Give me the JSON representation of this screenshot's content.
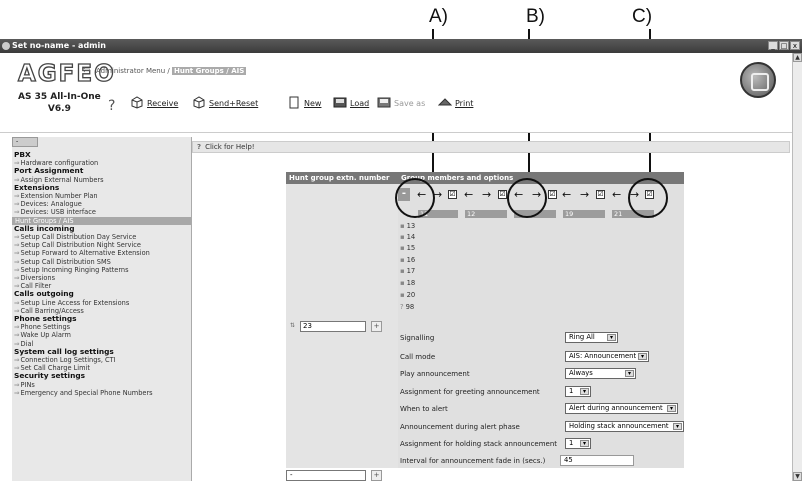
{
  "callouts": [
    "A)",
    "B)",
    "C)"
  ],
  "window": {
    "title": "Set no-name - admin",
    "min": "_",
    "max": "□",
    "close": "x"
  },
  "header": {
    "logo": "AGFEO",
    "nav_arrow": "⇦",
    "breadcrumb_admin": "Administrator Menu /",
    "breadcrumb_current": "Hunt Groups / AIS",
    "model_line1": "AS 35 All-In-One",
    "model_line2": "V6.9",
    "help": "?",
    "toolbar": [
      {
        "label": "Receive",
        "icon": "receive-icon"
      },
      {
        "label": "Send+Reset",
        "icon": "send-reset-icon"
      },
      {
        "label": "New",
        "icon": "new-icon"
      },
      {
        "label": "Load",
        "icon": "load-icon"
      },
      {
        "label": "Save as",
        "icon": "save-as-icon"
      },
      {
        "label": "Print",
        "icon": "print-icon"
      }
    ]
  },
  "sidebar": {
    "collapse": "-",
    "items": [
      {
        "type": "section",
        "label": "PBX"
      },
      {
        "type": "item",
        "label": "Hardware configuration"
      },
      {
        "type": "section",
        "label": "Port Assignment"
      },
      {
        "type": "item",
        "label": "Assign External Numbers"
      },
      {
        "type": "section",
        "label": "Extensions"
      },
      {
        "type": "item",
        "label": "Extension Number Plan"
      },
      {
        "type": "item",
        "label": "Devices: Analogue"
      },
      {
        "type": "item",
        "label": "Devices: USB interface"
      },
      {
        "type": "active",
        "label": "Hunt Groups / AIS"
      },
      {
        "type": "section",
        "label": "Calls incoming"
      },
      {
        "type": "item",
        "label": "Setup Call Distribution Day Service"
      },
      {
        "type": "item",
        "label": "Setup Call Distribution Night Service"
      },
      {
        "type": "item",
        "label": "Setup Forward to Alternative Extension"
      },
      {
        "type": "item",
        "label": "Setup Call Distribution SMS"
      },
      {
        "type": "item",
        "label": "Setup Incoming Ringing Patterns"
      },
      {
        "type": "item",
        "label": "Diversions"
      },
      {
        "type": "item",
        "label": "Call Filter"
      },
      {
        "type": "section",
        "label": "Calls outgoing"
      },
      {
        "type": "item",
        "label": "Setup Line Access for Extensions"
      },
      {
        "type": "item",
        "label": "Call Barring/Access"
      },
      {
        "type": "section",
        "label": "Phone settings"
      },
      {
        "type": "item",
        "label": "Phone Settings"
      },
      {
        "type": "item",
        "label": "Wake Up Alarm"
      },
      {
        "type": "item",
        "label": "Dial"
      },
      {
        "type": "section",
        "label": "System call log settings"
      },
      {
        "type": "item",
        "label": "Connection Log Settings, CTI"
      },
      {
        "type": "item",
        "label": "Set Call Charge Limit"
      },
      {
        "type": "section",
        "label": "Security settings"
      },
      {
        "type": "item",
        "label": "PINs"
      },
      {
        "type": "item",
        "label": "Emergency and Special Phone Numbers"
      }
    ]
  },
  "helpbar": {
    "icon": "?",
    "text": "Click for Help!"
  },
  "form": {
    "col1_header": "Hunt group extn. number",
    "col2_header": "Group members and options",
    "member_controls": [
      "-",
      "←",
      "→",
      "☑",
      "←",
      "→",
      "☑",
      "←",
      "→",
      "☑",
      "←",
      "→",
      "☑",
      "←",
      "→",
      "☑"
    ],
    "group_cells": [
      "11",
      "12",
      "18",
      "19",
      "21"
    ],
    "members": [
      "13",
      "14",
      "15",
      "16",
      "17",
      "18",
      "20",
      "98"
    ],
    "ext_number": "23",
    "ext_plus": "+",
    "options": [
      {
        "label": "Signalling",
        "value": "Ring All"
      },
      {
        "label": "Call mode",
        "value": "AIS: Announcement"
      },
      {
        "label": "Play announcement",
        "value": "Always"
      },
      {
        "label": "Assignment for greeting announcement",
        "value": "1"
      },
      {
        "label": "When to alert",
        "value": "Alert during announcement"
      },
      {
        "label": "Announcement during alert phase",
        "value": "Holding stack announcement"
      },
      {
        "label": "Assignment for holding stack announcement",
        "value": "1"
      },
      {
        "label": "Interval for announcement fade in (secs.)",
        "value": "45"
      }
    ],
    "ext2_value": "-",
    "ext2_plus": "+"
  },
  "scrollbar": {
    "up": "▲",
    "down": "▼"
  }
}
